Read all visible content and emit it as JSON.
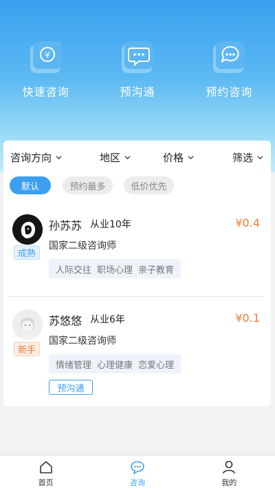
{
  "quick_actions": [
    {
      "label": "快速咨询",
      "icon": "yen-chat-icon"
    },
    {
      "label": "预沟通",
      "icon": "message-dots-icon"
    },
    {
      "label": "预约咨询",
      "icon": "chat-bubble-icon"
    }
  ],
  "filters": [
    {
      "label": "咨询方向"
    },
    {
      "label": "地区"
    },
    {
      "label": "价格"
    },
    {
      "label": "筛选"
    }
  ],
  "sort_chips": [
    {
      "label": "默认",
      "active": true
    },
    {
      "label": "预约最多",
      "active": false
    },
    {
      "label": "低价优先",
      "active": false
    }
  ],
  "counselors": [
    {
      "name": "孙苏苏",
      "years": "从业10年",
      "price": "¥0.4",
      "title": "国家二级咨询师",
      "level": "成熟",
      "tags": [
        "人际交往",
        "职场心理",
        "亲子教育"
      ]
    },
    {
      "name": "苏悠悠",
      "years": "从业6年",
      "price": "¥0.1",
      "title": "国家二级咨询师",
      "level": "新手",
      "tags": [
        "情绪管理",
        "心理健康",
        "恋爱心理"
      ],
      "badge": "预沟通"
    }
  ],
  "tabbar": [
    {
      "label": "首页",
      "active": false
    },
    {
      "label": "咨询",
      "active": true
    },
    {
      "label": "我的",
      "active": false
    }
  ],
  "colors": {
    "accent": "#3d9ff0",
    "price": "#f07b3a"
  }
}
